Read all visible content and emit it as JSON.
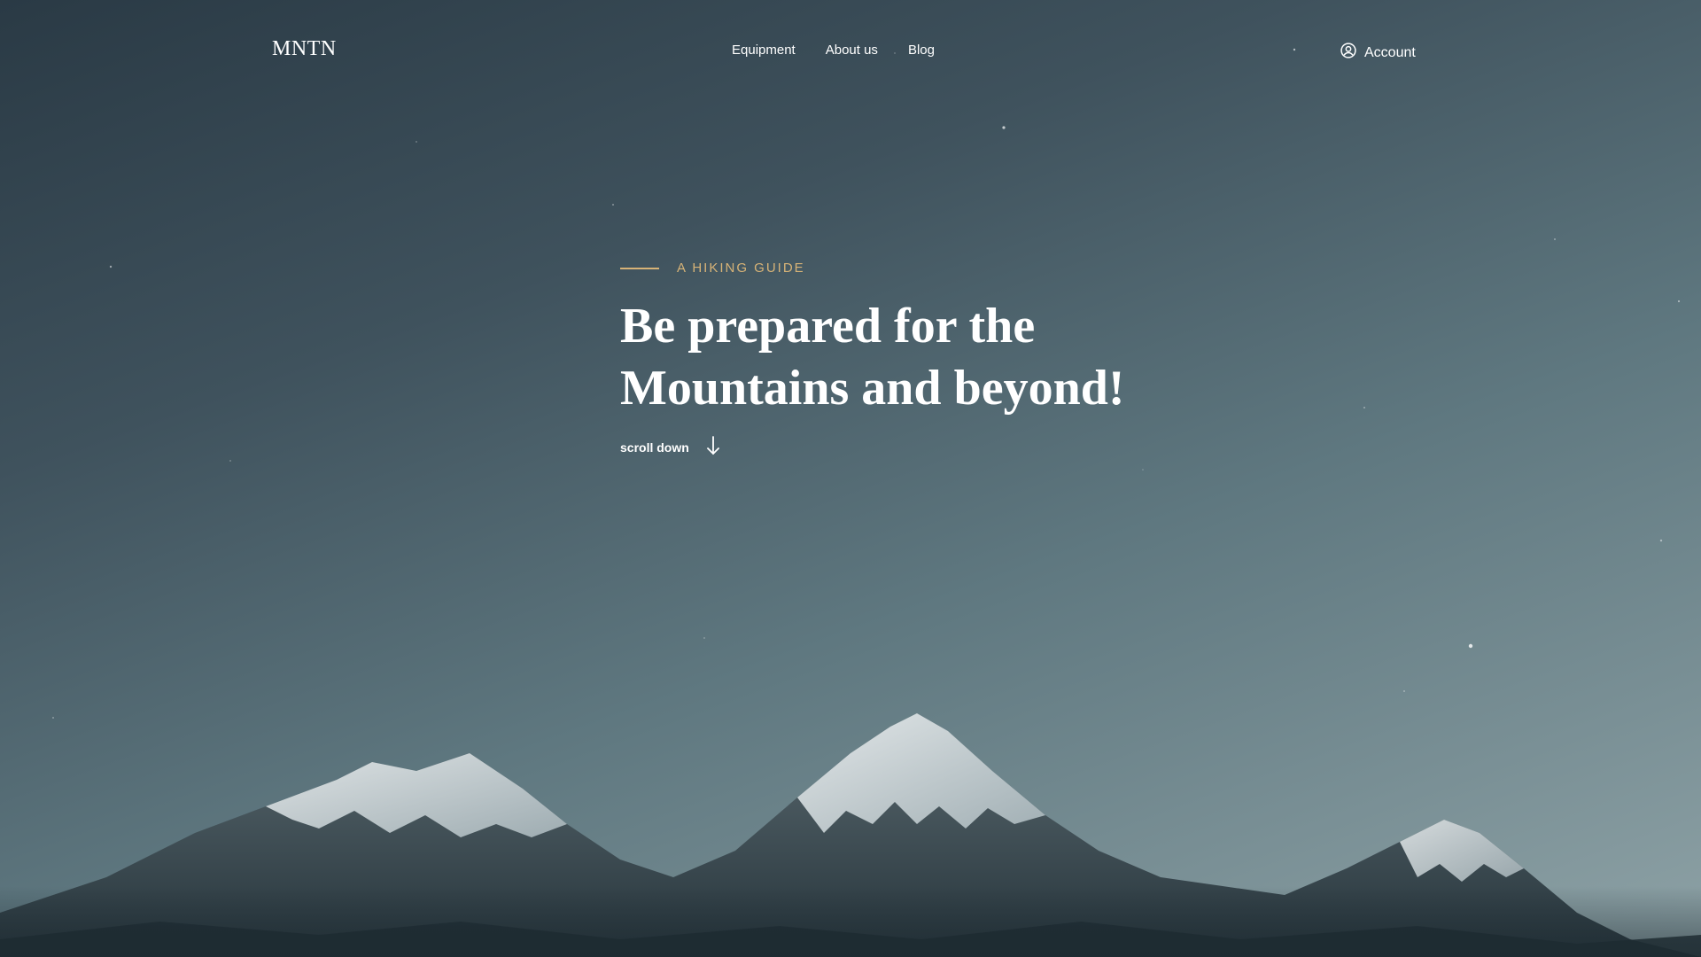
{
  "brand": {
    "logo_text": "MNTN"
  },
  "nav": {
    "items": [
      {
        "label": "Equipment"
      },
      {
        "label": "About us"
      },
      {
        "label": "Blog"
      }
    ]
  },
  "account": {
    "label": "Account",
    "icon": "user-circle-icon"
  },
  "hero": {
    "eyebrow": "A HIKING GUIDE",
    "title_line_1": "Be prepared for the",
    "title_line_2": "Mountains and beyond!",
    "scroll_label": "scroll down",
    "scroll_icon": "arrow-down-icon"
  },
  "colors": {
    "accent": "#d7b377",
    "text": "#ffffff",
    "sky_top": "#2a3a45",
    "sky_bottom": "#8ea2a6"
  }
}
